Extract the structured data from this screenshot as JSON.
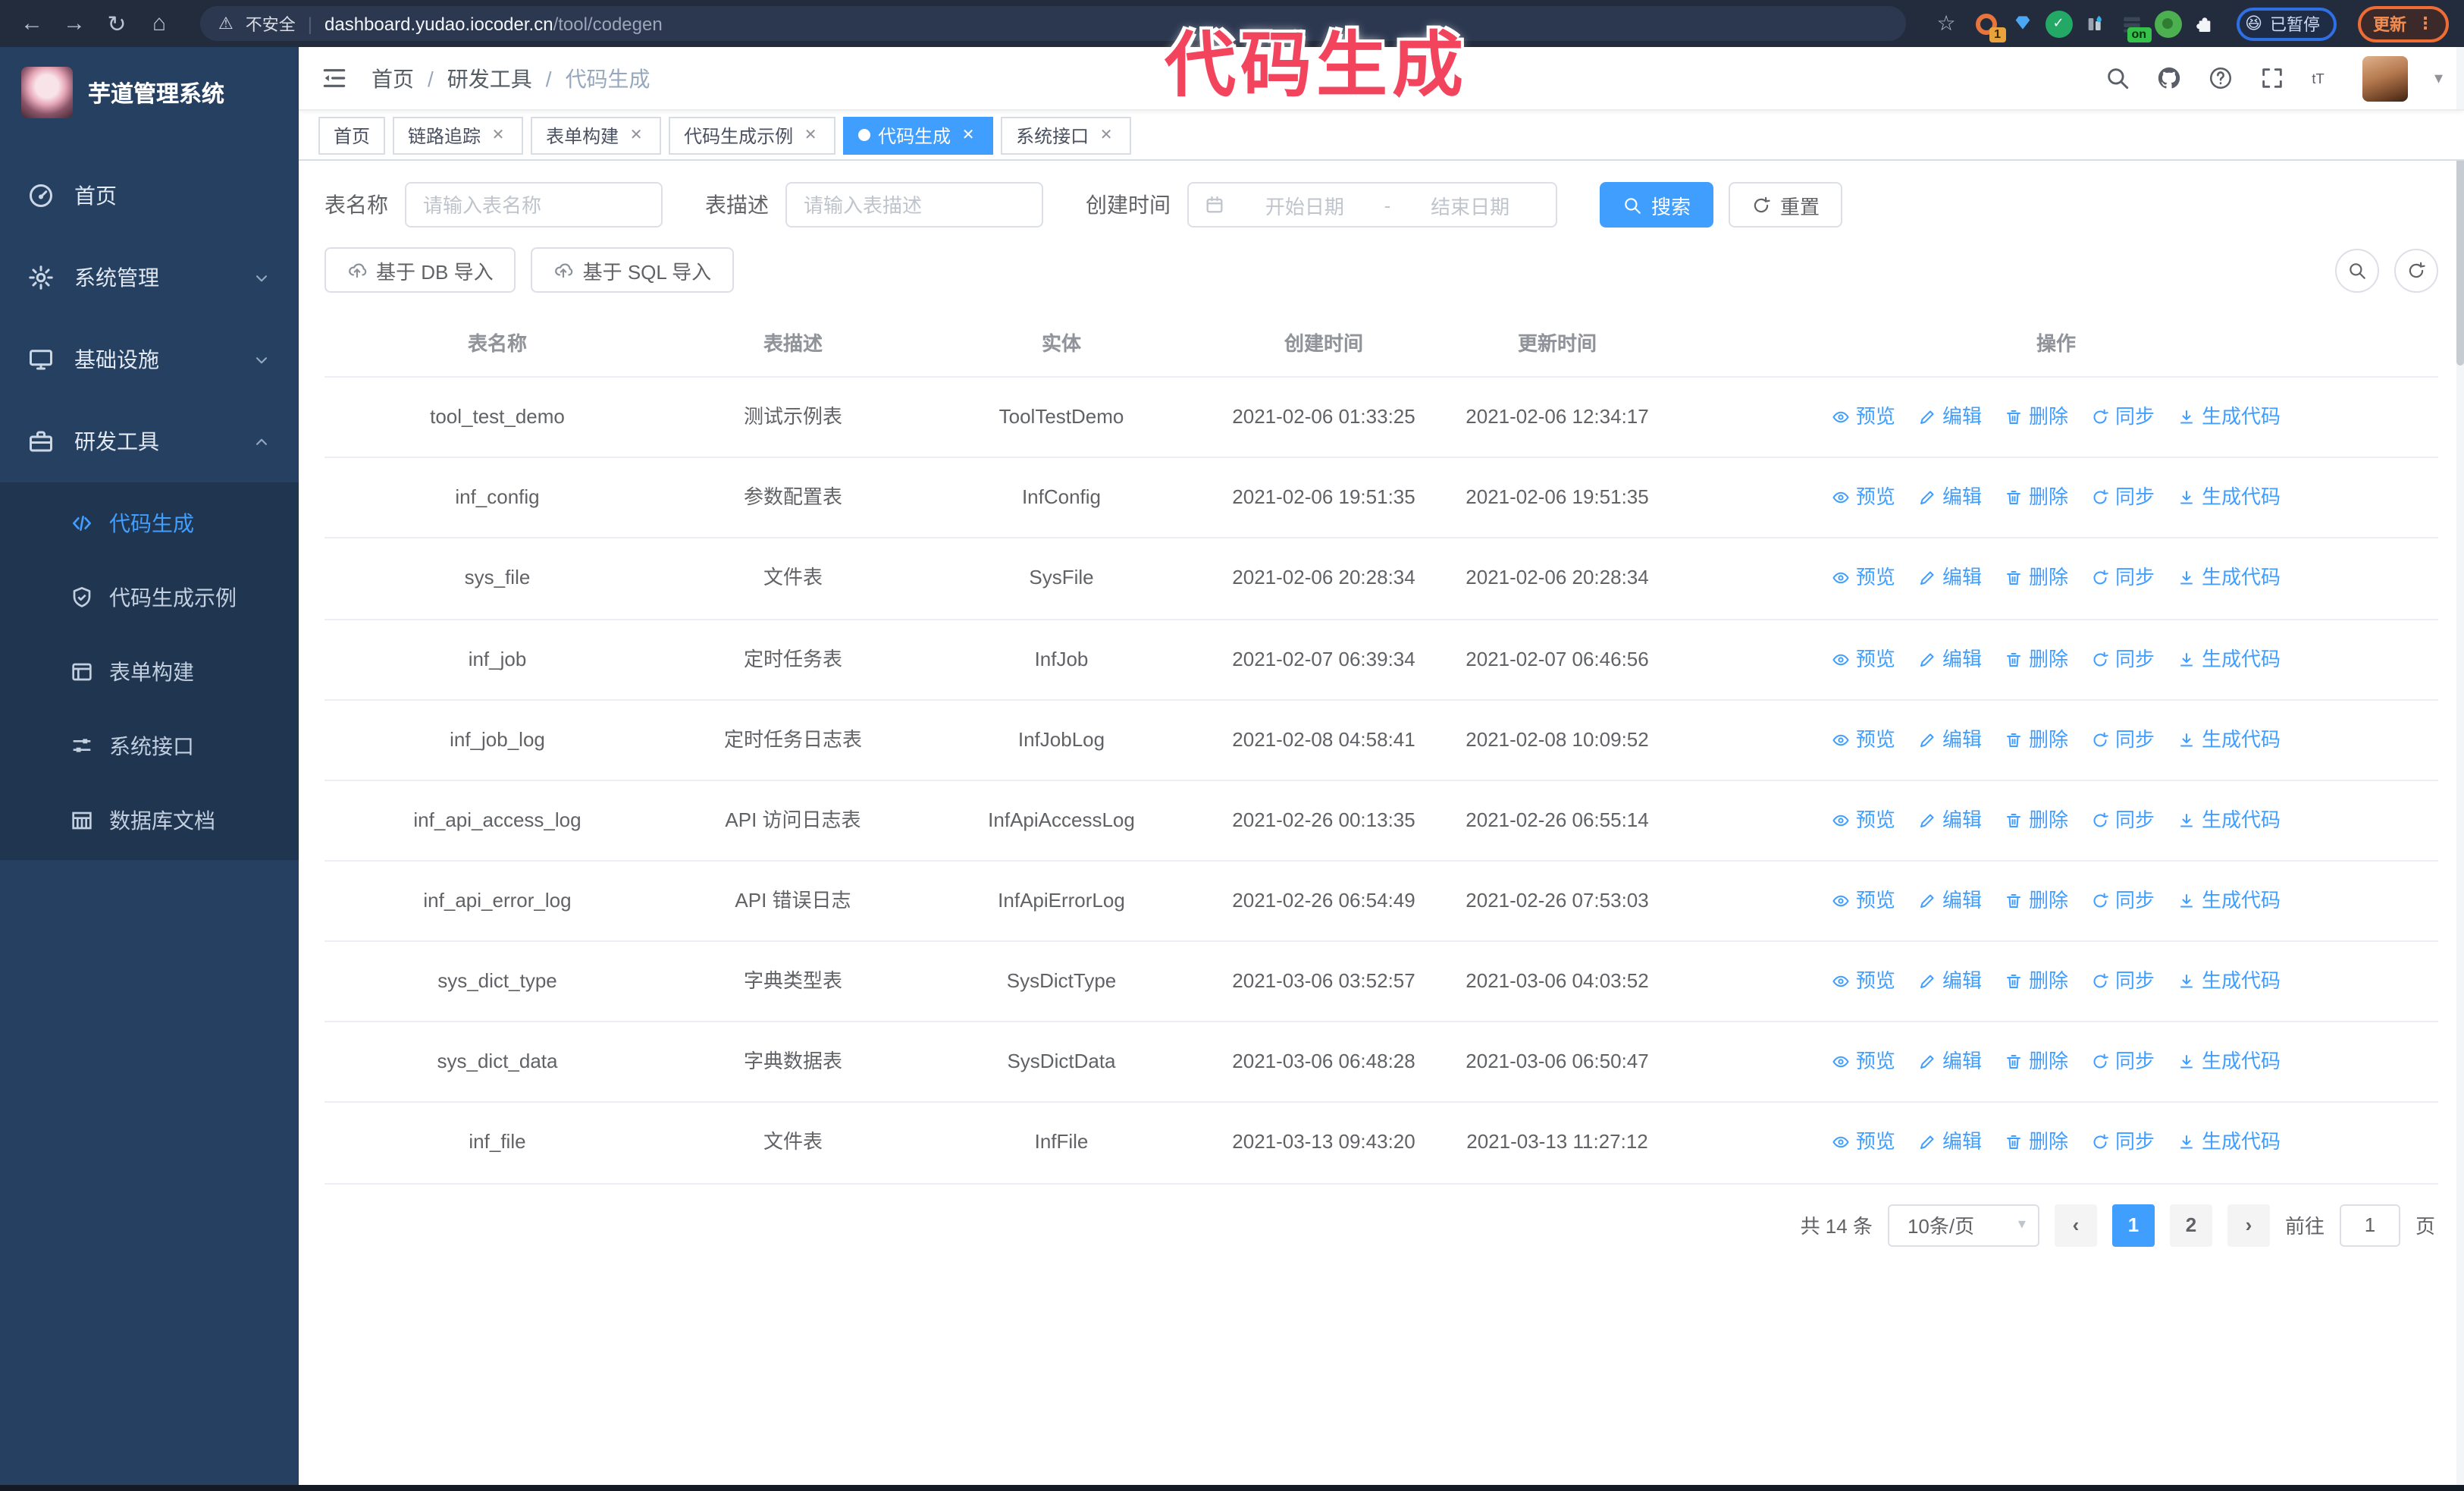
{
  "browser": {
    "security_label": "不安全",
    "url_host": "dashboard.yudao.iocoder.cn",
    "url_path": "/tool/codegen",
    "extension_badge": "1",
    "extension_on_badge": "on",
    "paused_badge": "已暂停",
    "update_button": "更新"
  },
  "annotation": {
    "text": "代码生成",
    "color": "#f2455d"
  },
  "icons": {
    "back": "←",
    "forward": "→",
    "reload": "↻",
    "home": "⌂",
    "star": "☆",
    "close": "✕",
    "caret_down": "▾",
    "warning": "⚠",
    "divider": "|",
    "emoji_paused": "😆",
    "kebab": "⋮",
    "breadcrumb_sep": "/",
    "pager_prev": "‹",
    "pager_next": "›"
  },
  "sidebar": {
    "title": "芋道管理系统",
    "items": [
      {
        "label": "首页"
      },
      {
        "label": "系统管理"
      },
      {
        "label": "基础设施"
      },
      {
        "label": "研发工具"
      }
    ],
    "subitems": [
      {
        "label": "代码生成"
      },
      {
        "label": "代码生成示例"
      },
      {
        "label": "表单构建"
      },
      {
        "label": "系统接口"
      },
      {
        "label": "数据库文档"
      }
    ]
  },
  "header": {
    "breadcrumb": [
      "首页",
      "研发工具",
      "代码生成"
    ]
  },
  "tabs": [
    {
      "label": "首页"
    },
    {
      "label": "链路追踪"
    },
    {
      "label": "表单构建"
    },
    {
      "label": "代码生成示例"
    },
    {
      "label": "代码生成"
    },
    {
      "label": "系统接口"
    }
  ],
  "filters": {
    "table_name_label": "表名称",
    "table_name_placeholder": "请输入表名称",
    "table_desc_label": "表描述",
    "table_desc_placeholder": "请输入表描述",
    "create_time_label": "创建时间",
    "start_date_placeholder": "开始日期",
    "range_separator": "-",
    "end_date_placeholder": "结束日期",
    "search_label": "搜索",
    "reset_label": "重置"
  },
  "toolbar": {
    "import_db_label": "基于 DB 导入",
    "import_sql_label": "基于 SQL 导入"
  },
  "table": {
    "columns": [
      "表名称",
      "表描述",
      "实体",
      "创建时间",
      "更新时间",
      "操作"
    ],
    "actions": [
      "预览",
      "编辑",
      "删除",
      "同步",
      "生成代码"
    ],
    "rows": [
      {
        "name": "tool_test_demo",
        "desc": "测试示例表",
        "entity": "ToolTestDemo",
        "create_time": "2021-02-06 01:33:25",
        "update_time": "2021-02-06 12:34:17"
      },
      {
        "name": "inf_config",
        "desc": "参数配置表",
        "entity": "InfConfig",
        "create_time": "2021-02-06 19:51:35",
        "update_time": "2021-02-06 19:51:35"
      },
      {
        "name": "sys_file",
        "desc": "文件表",
        "entity": "SysFile",
        "create_time": "2021-02-06 20:28:34",
        "update_time": "2021-02-06 20:28:34"
      },
      {
        "name": "inf_job",
        "desc": "定时任务表",
        "entity": "InfJob",
        "create_time": "2021-02-07 06:39:34",
        "update_time": "2021-02-07 06:46:56"
      },
      {
        "name": "inf_job_log",
        "desc": "定时任务日志表",
        "entity": "InfJobLog",
        "create_time": "2021-02-08 04:58:41",
        "update_time": "2021-02-08 10:09:52"
      },
      {
        "name": "inf_api_access_log",
        "desc": "API 访问日志表",
        "entity": "InfApiAccessLog",
        "create_time": "2021-02-26 00:13:35",
        "update_time": "2021-02-26 06:55:14"
      },
      {
        "name": "inf_api_error_log",
        "desc": "API 错误日志",
        "entity": "InfApiErrorLog",
        "create_time": "2021-02-26 06:54:49",
        "update_time": "2021-02-26 07:53:03"
      },
      {
        "name": "sys_dict_type",
        "desc": "字典类型表",
        "entity": "SysDictType",
        "create_time": "2021-03-06 03:52:57",
        "update_time": "2021-03-06 04:03:52"
      },
      {
        "name": "sys_dict_data",
        "desc": "字典数据表",
        "entity": "SysDictData",
        "create_time": "2021-03-06 06:48:28",
        "update_time": "2021-03-06 06:50:47"
      },
      {
        "name": "inf_file",
        "desc": "文件表",
        "entity": "InfFile",
        "create_time": "2021-03-13 09:43:20",
        "update_time": "2021-03-13 11:27:12"
      }
    ]
  },
  "pagination": {
    "total_label": "共 14 条",
    "page_size": "10条/页",
    "pages": [
      "1",
      "2"
    ],
    "current_page": "1",
    "goto_label": "前往",
    "goto_value": "1",
    "page_suffix": "页"
  },
  "colors": {
    "primary": "#409eff",
    "annotation": "#f2455d",
    "sidebar_bg": "#254061",
    "browser_bar_bg": "#222c3c"
  }
}
